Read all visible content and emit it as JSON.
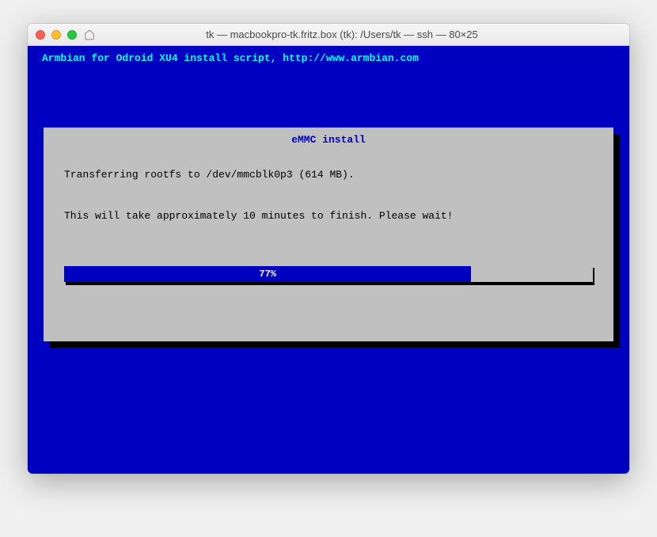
{
  "window": {
    "title": "tk — macbookpro-tk.fritz.box (tk): /Users/tk — ssh — 80×25"
  },
  "terminal": {
    "header": "Armbian for Odroid XU4 install script, http://www.armbian.com"
  },
  "dialog": {
    "title": "eMMC install",
    "line1": "Transferring rootfs to /dev/mmcblk0p3 (614 MB).",
    "line2": "This will take approximately 10 minutes to finish. Please wait!"
  },
  "progress": {
    "percent": 77,
    "label": "77%"
  }
}
